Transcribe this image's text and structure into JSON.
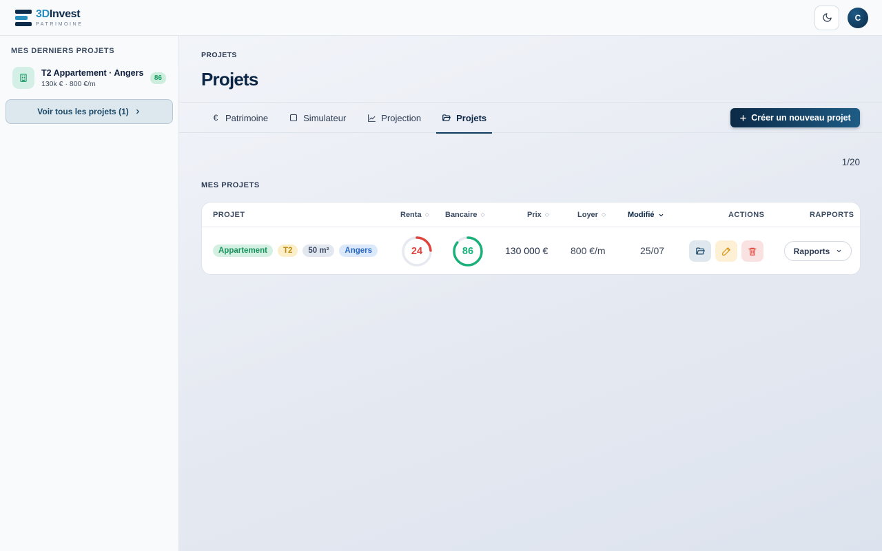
{
  "app": {
    "name_main": "3D",
    "name_rest": "Invest",
    "subtitle": "PATRIMOINE",
    "avatar_initial": "C",
    "colors": {
      "primary": "#0b2a46",
      "accent": "#2a8fc0",
      "success": "#1ab07a",
      "danger": "#e0443e"
    }
  },
  "sidebar": {
    "title": "MES DERNIERS PROJETS",
    "recent": [
      {
        "name": "T2 Appartement · Angers",
        "meta": "130k € · 800 €/m",
        "score": "86",
        "icon": "building-icon"
      }
    ],
    "view_all_label": "Voir tous les projets (1)"
  },
  "main": {
    "breadcrumb": "PROJETS",
    "title": "Projets",
    "tabs": [
      {
        "label": "Patrimoine",
        "icon": "euro-icon"
      },
      {
        "label": "Simulateur",
        "icon": "square-icon"
      },
      {
        "label": "Projection",
        "icon": "chart-line-icon"
      },
      {
        "label": "Projets",
        "icon": "folder-open-icon",
        "active": true
      }
    ],
    "new_project_label": "Créer un nouveau projet",
    "pager": "1/20",
    "section_label": "MES PROJETS",
    "table": {
      "headers": {
        "projet": "PROJET",
        "renta": "Renta",
        "bancaire": "Bancaire",
        "prix": "Prix",
        "loyer": "Loyer",
        "modifie": "Modifié",
        "actions": "ACTIONS",
        "rapports": "RAPPORTS"
      },
      "rows": [
        {
          "tags": [
            "Appartement",
            "T2",
            "50 m²",
            "Angers"
          ],
          "renta": 24,
          "bancaire": 86,
          "prix": "130 000 €",
          "loyer": "800 €/m",
          "modifie": "25/07",
          "reports_label": "Rapports"
        }
      ]
    }
  }
}
